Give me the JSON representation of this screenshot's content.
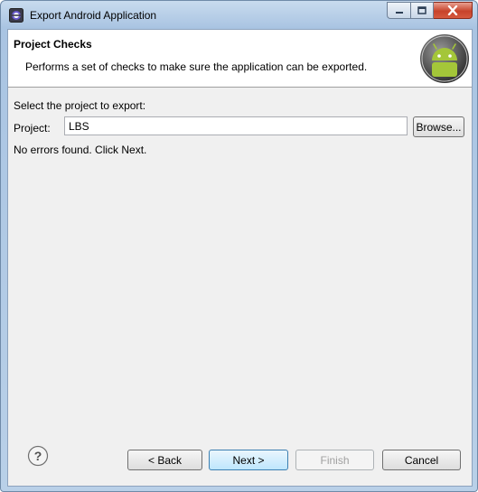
{
  "window": {
    "title": "Export Android Application"
  },
  "header": {
    "title": "Project Checks",
    "description": "Performs a set of checks to make sure the application can be exported."
  },
  "main": {
    "section_label": "Select the project to export:",
    "project_label": "Project:",
    "project_value": "LBS",
    "browse_label": "Browse...",
    "status_text": "No errors found. Click Next."
  },
  "footer": {
    "back_label": "< Back",
    "next_label": "Next >",
    "finish_label": "Finish",
    "cancel_label": "Cancel"
  },
  "icons": {
    "app": "eclipse-icon",
    "logo": "android-logo-icon",
    "help": "help-icon",
    "minimize": "minimize-icon",
    "maximize": "maximize-icon",
    "close": "close-icon"
  },
  "colors": {
    "android_green": "#a4c639",
    "titlebar": "#b9d0e8",
    "close_red": "#c7432b"
  }
}
